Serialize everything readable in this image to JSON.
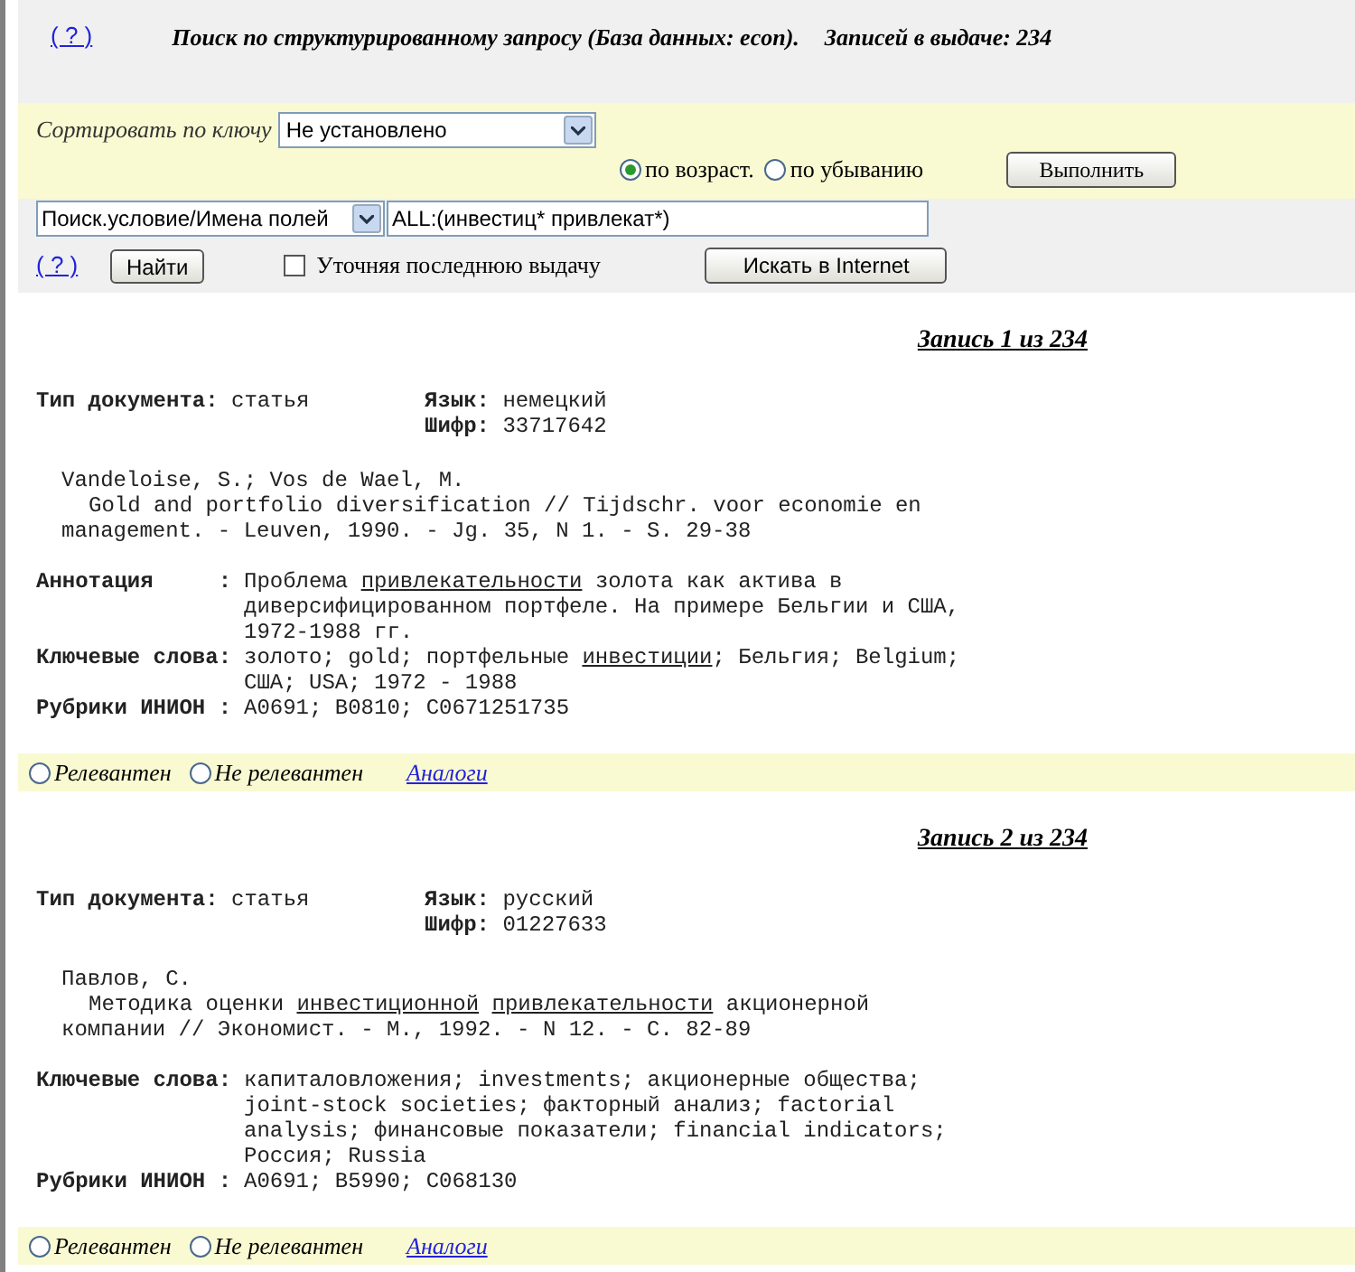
{
  "header": {
    "help_link": "( ? )",
    "title": "Поиск по структурированному запросу (База данных: econ).",
    "count": "Записей в выдаче: 234"
  },
  "sort": {
    "label": "Сортировать по ключу",
    "select_value": "Не установлено",
    "order_options": [
      {
        "label": "по возраст.",
        "selected": true
      },
      {
        "label": "по убыванию",
        "selected": false
      }
    ],
    "run_button": "Выполнить"
  },
  "search": {
    "field_select": "Поиск.условие/Имена полей",
    "query": "ALL:(инвестиц* привлекат*)",
    "help_link": "( ? )",
    "find_button": "Найти",
    "refine": {
      "label": "Уточняя последнюю выдачу",
      "checked": false
    },
    "internet_button": "Искать в Internet"
  },
  "records": [
    {
      "title": "Запись 1 из 234",
      "doc_type": {
        "label": "Тип документа:",
        "value": "статья"
      },
      "language": {
        "label": "Язык:",
        "value": "немецкий"
      },
      "code": {
        "label": "Шифр:",
        "value": "33717642"
      },
      "author": "Vandeloise, S.; Vos de Wael, M.",
      "citation": [
        [
          {
            "text": "Gold and portfolio diversification // Tijdschr. voor economie en",
            "underline": false
          }
        ],
        [
          {
            "text": "management. - Leuven, 1990. - Jg. 35, N 1. - S. 29-38",
            "underline": false
          }
        ]
      ],
      "fields": [
        {
          "label": "Аннотация     :",
          "lines": [
            [
              {
                "text": "Проблема ",
                "underline": false
              },
              {
                "text": "привлекательности",
                "underline": true
              },
              {
                "text": " золота как актива в",
                "underline": false
              }
            ],
            [
              {
                "text": "диверсифицированном портфеле. На примере Бельгии и США,",
                "underline": false
              }
            ],
            [
              {
                "text": "1972-1988 гг.",
                "underline": false
              }
            ]
          ]
        },
        {
          "label": "Ключевые слова:",
          "lines": [
            [
              {
                "text": "золото; gold; портфельные ",
                "underline": false
              },
              {
                "text": "инвестиции",
                "underline": true
              },
              {
                "text": "; Бельгия; Belgium;",
                "underline": false
              }
            ],
            [
              {
                "text": "США; USA; 1972 - 1988",
                "underline": false
              }
            ]
          ]
        },
        {
          "label": "Рубрики ИНИОН :",
          "lines": [
            [
              {
                "text": "A0691; B0810; C0671251735",
                "underline": false
              }
            ]
          ]
        }
      ],
      "relevance": {
        "options": [
          {
            "label": "Релевантен",
            "selected": false
          },
          {
            "label": "Не релевантен",
            "selected": false
          }
        ],
        "analogs_link": "Аналоги"
      }
    },
    {
      "title": "Запись 2 из 234",
      "doc_type": {
        "label": "Тип документа:",
        "value": "статья"
      },
      "language": {
        "label": "Язык:",
        "value": "русский"
      },
      "code": {
        "label": "Шифр:",
        "value": "01227633"
      },
      "author": "Павлов, С.",
      "citation": [
        [
          {
            "text": "Методика оценки ",
            "underline": false
          },
          {
            "text": "инвестиционной",
            "underline": true
          },
          {
            "text": " привлекательности",
            "underline": true
          },
          {
            "text": " акционерной",
            "underline": false
          }
        ],
        [
          {
            "text": "компании // Экономист. - М., 1992. - N 12. - С. 82-89",
            "underline": false
          }
        ]
      ],
      "fields": [
        {
          "label": "Ключевые слова:",
          "lines": [
            [
              {
                "text": "капиталовложения; investments; акционерные общества;",
                "underline": false
              }
            ],
            [
              {
                "text": "joint-stock societies; факторный анализ; factorial",
                "underline": false
              }
            ],
            [
              {
                "text": "analysis; финансовые показатели; financial indicators;",
                "underline": false
              }
            ],
            [
              {
                "text": "Россия; Russia",
                "underline": false
              }
            ]
          ]
        },
        {
          "label": "Рубрики ИНИОН :",
          "lines": [
            [
              {
                "text": "A0691; B5990; C068130",
                "underline": false
              }
            ]
          ]
        }
      ],
      "relevance": {
        "options": [
          {
            "label": "Релевантен",
            "selected": false
          },
          {
            "label": "Не релевантен",
            "selected": false
          }
        ],
        "analogs_link": "Аналоги"
      }
    }
  ]
}
